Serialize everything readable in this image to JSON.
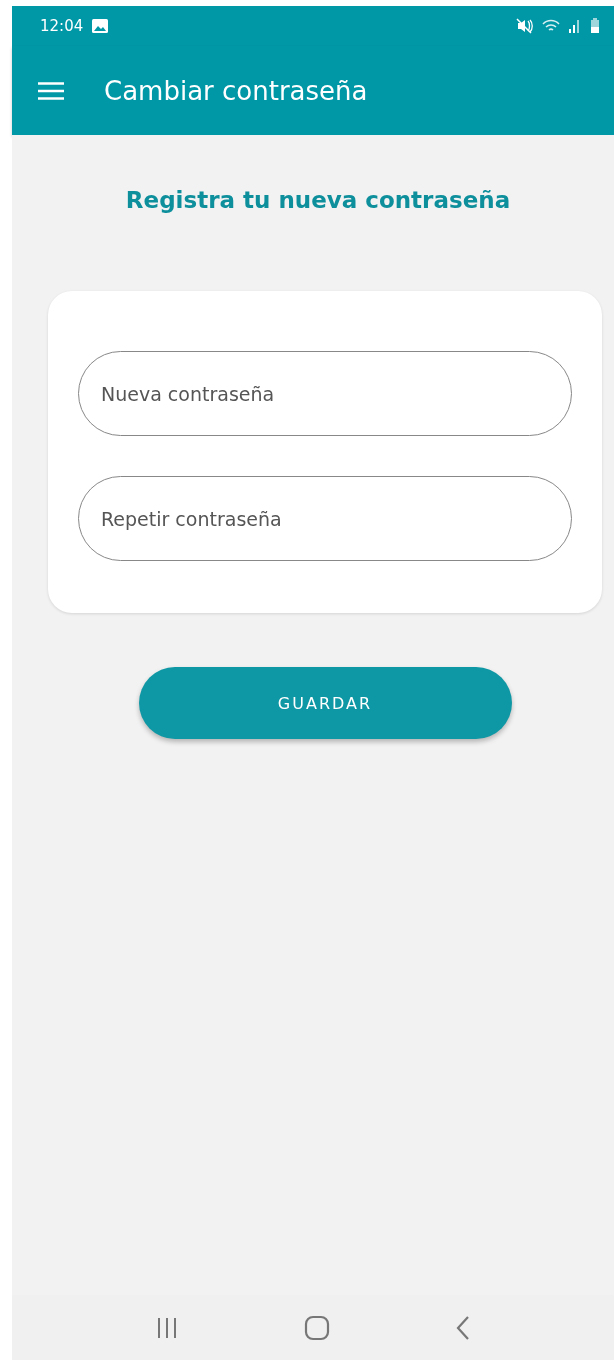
{
  "status_bar": {
    "time": "12:04"
  },
  "app_bar": {
    "title": "Cambiar contraseña"
  },
  "heading": "Registra tu nueva contraseña",
  "fields": [
    {
      "placeholder": "Nueva contraseña"
    },
    {
      "placeholder": "Repetir contraseña"
    }
  ],
  "button": "GUARDAR"
}
